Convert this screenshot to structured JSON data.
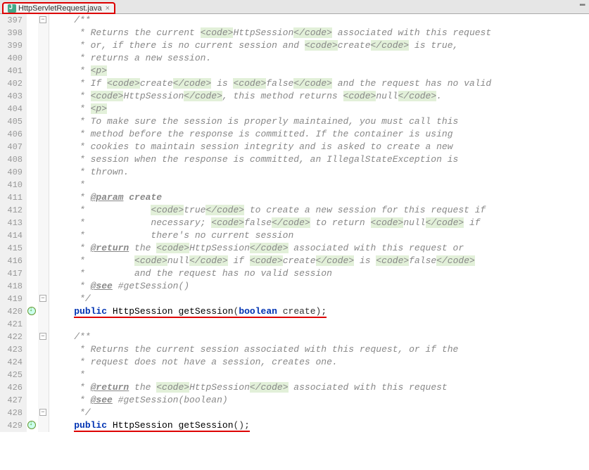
{
  "tab": {
    "label": "HttpServletRequest.java"
  },
  "lines": [
    {
      "n": 397,
      "fold": "-",
      "html": "<span class='doc'>/**</span>"
    },
    {
      "n": 398,
      "html": "<span class='doc'> * Returns the current </span><span class='code-tag'>&lt;code&gt;</span><span class='doc'>HttpSession</span><span class='code-tag'>&lt;/code&gt;</span><span class='doc'> associated with this request</span>"
    },
    {
      "n": 399,
      "html": "<span class='doc'> * or, if there is no current session and </span><span class='code-tag'>&lt;code&gt;</span><span class='doc'>create</span><span class='code-tag'>&lt;/code&gt;</span><span class='doc'> is true,</span>"
    },
    {
      "n": 400,
      "html": "<span class='doc'> * returns a new session.</span>"
    },
    {
      "n": 401,
      "html": "<span class='doc'> * </span><span class='code-tag'>&lt;p&gt;</span>"
    },
    {
      "n": 402,
      "html": "<span class='doc'> * If </span><span class='code-tag'>&lt;code&gt;</span><span class='doc'>create</span><span class='code-tag'>&lt;/code&gt;</span><span class='doc'> is </span><span class='code-tag'>&lt;code&gt;</span><span class='doc'>false</span><span class='code-tag'>&lt;/code&gt;</span><span class='doc'> and the request has no valid</span>"
    },
    {
      "n": 403,
      "html": "<span class='doc'> * </span><span class='code-tag'>&lt;code&gt;</span><span class='doc'>HttpSession</span><span class='code-tag'>&lt;/code&gt;</span><span class='doc'>, this method returns </span><span class='code-tag'>&lt;code&gt;</span><span class='doc'>null</span><span class='code-tag'>&lt;/code&gt;</span><span class='doc'>.</span>"
    },
    {
      "n": 404,
      "html": "<span class='doc'> * </span><span class='code-tag'>&lt;p&gt;</span>"
    },
    {
      "n": 405,
      "html": "<span class='doc'> * To make sure the session is properly maintained, you must call this</span>"
    },
    {
      "n": 406,
      "html": "<span class='doc'> * method before the response is committed. If the container is using</span>"
    },
    {
      "n": 407,
      "html": "<span class='doc'> * cookies to maintain session integrity and is asked to create a new</span>"
    },
    {
      "n": 408,
      "html": "<span class='doc'> * session when the response is committed, an IllegalStateException is</span>"
    },
    {
      "n": 409,
      "html": "<span class='doc'> * thrown.</span>"
    },
    {
      "n": 410,
      "html": "<span class='doc'> *</span>"
    },
    {
      "n": 411,
      "html": "<span class='doc'> * </span><span class='doc-tag'>@param</span><span class='doc'> <b>create</b></span>"
    },
    {
      "n": 412,
      "html": "<span class='doc'> *            </span><span class='code-tag'>&lt;code&gt;</span><span class='doc'>true</span><span class='code-tag'>&lt;/code&gt;</span><span class='doc'> to create a new session for this request if</span>"
    },
    {
      "n": 413,
      "html": "<span class='doc'> *            necessary; </span><span class='code-tag'>&lt;code&gt;</span><span class='doc'>false</span><span class='code-tag'>&lt;/code&gt;</span><span class='doc'> to return </span><span class='code-tag'>&lt;code&gt;</span><span class='doc'>null</span><span class='code-tag'>&lt;/code&gt;</span><span class='doc'> if</span>"
    },
    {
      "n": 414,
      "html": "<span class='doc'> *            there's no current session</span>"
    },
    {
      "n": 415,
      "html": "<span class='doc'> * </span><span class='doc-tag'>@return</span><span class='doc'> the </span><span class='code-tag'>&lt;code&gt;</span><span class='doc'>HttpSession</span><span class='code-tag'>&lt;/code&gt;</span><span class='doc'> associated with this request or</span>"
    },
    {
      "n": 416,
      "html": "<span class='doc'> *         </span><span class='code-tag'>&lt;code&gt;</span><span class='doc'>null</span><span class='code-tag'>&lt;/code&gt;</span><span class='doc'> if </span><span class='code-tag'>&lt;code&gt;</span><span class='doc'>create</span><span class='code-tag'>&lt;/code&gt;</span><span class='doc'> is </span><span class='code-tag'>&lt;code&gt;</span><span class='doc'>false</span><span class='code-tag'>&lt;/code&gt;</span>"
    },
    {
      "n": 417,
      "html": "<span class='doc'> *         and the request has no valid session</span>"
    },
    {
      "n": 418,
      "html": "<span class='doc'> * </span><span class='doc-tag'>@see</span><span class='doc-ref'> #getSession()</span>"
    },
    {
      "n": 419,
      "fold": "-",
      "html": "<span class='doc'> */</span>"
    },
    {
      "n": 420,
      "marker": true,
      "html": "<span class='sig-ul'><span class='kw'>public</span> <span class='type'>HttpSession</span> <span class='method'>getSession</span>(<span class='kw'>boolean</span> create);</span>"
    },
    {
      "n": 421,
      "html": ""
    },
    {
      "n": 422,
      "fold": "-",
      "html": "<span class='doc'>/**</span>"
    },
    {
      "n": 423,
      "html": "<span class='doc'> * Returns the current session associated with this request, or if the</span>"
    },
    {
      "n": 424,
      "html": "<span class='doc'> * request does not have a session, creates one.</span>"
    },
    {
      "n": 425,
      "html": "<span class='doc'> *</span>"
    },
    {
      "n": 426,
      "html": "<span class='doc'> * </span><span class='doc-tag'>@return</span><span class='doc'> the </span><span class='code-tag'>&lt;code&gt;</span><span class='doc'>HttpSession</span><span class='code-tag'>&lt;/code&gt;</span><span class='doc'> associated with this request</span>"
    },
    {
      "n": 427,
      "html": "<span class='doc'> * </span><span class='doc-tag'>@see</span><span class='doc-ref'> #getSession(boolean)</span>"
    },
    {
      "n": 428,
      "fold": "-",
      "html": "<span class='doc'> */</span>"
    },
    {
      "n": 429,
      "marker": true,
      "html": "<span class='sig-ul'><span class='kw'>public</span> <span class='type'>HttpSession</span> <span class='method'>getSession</span>();</span>"
    }
  ],
  "code_indent": "    "
}
